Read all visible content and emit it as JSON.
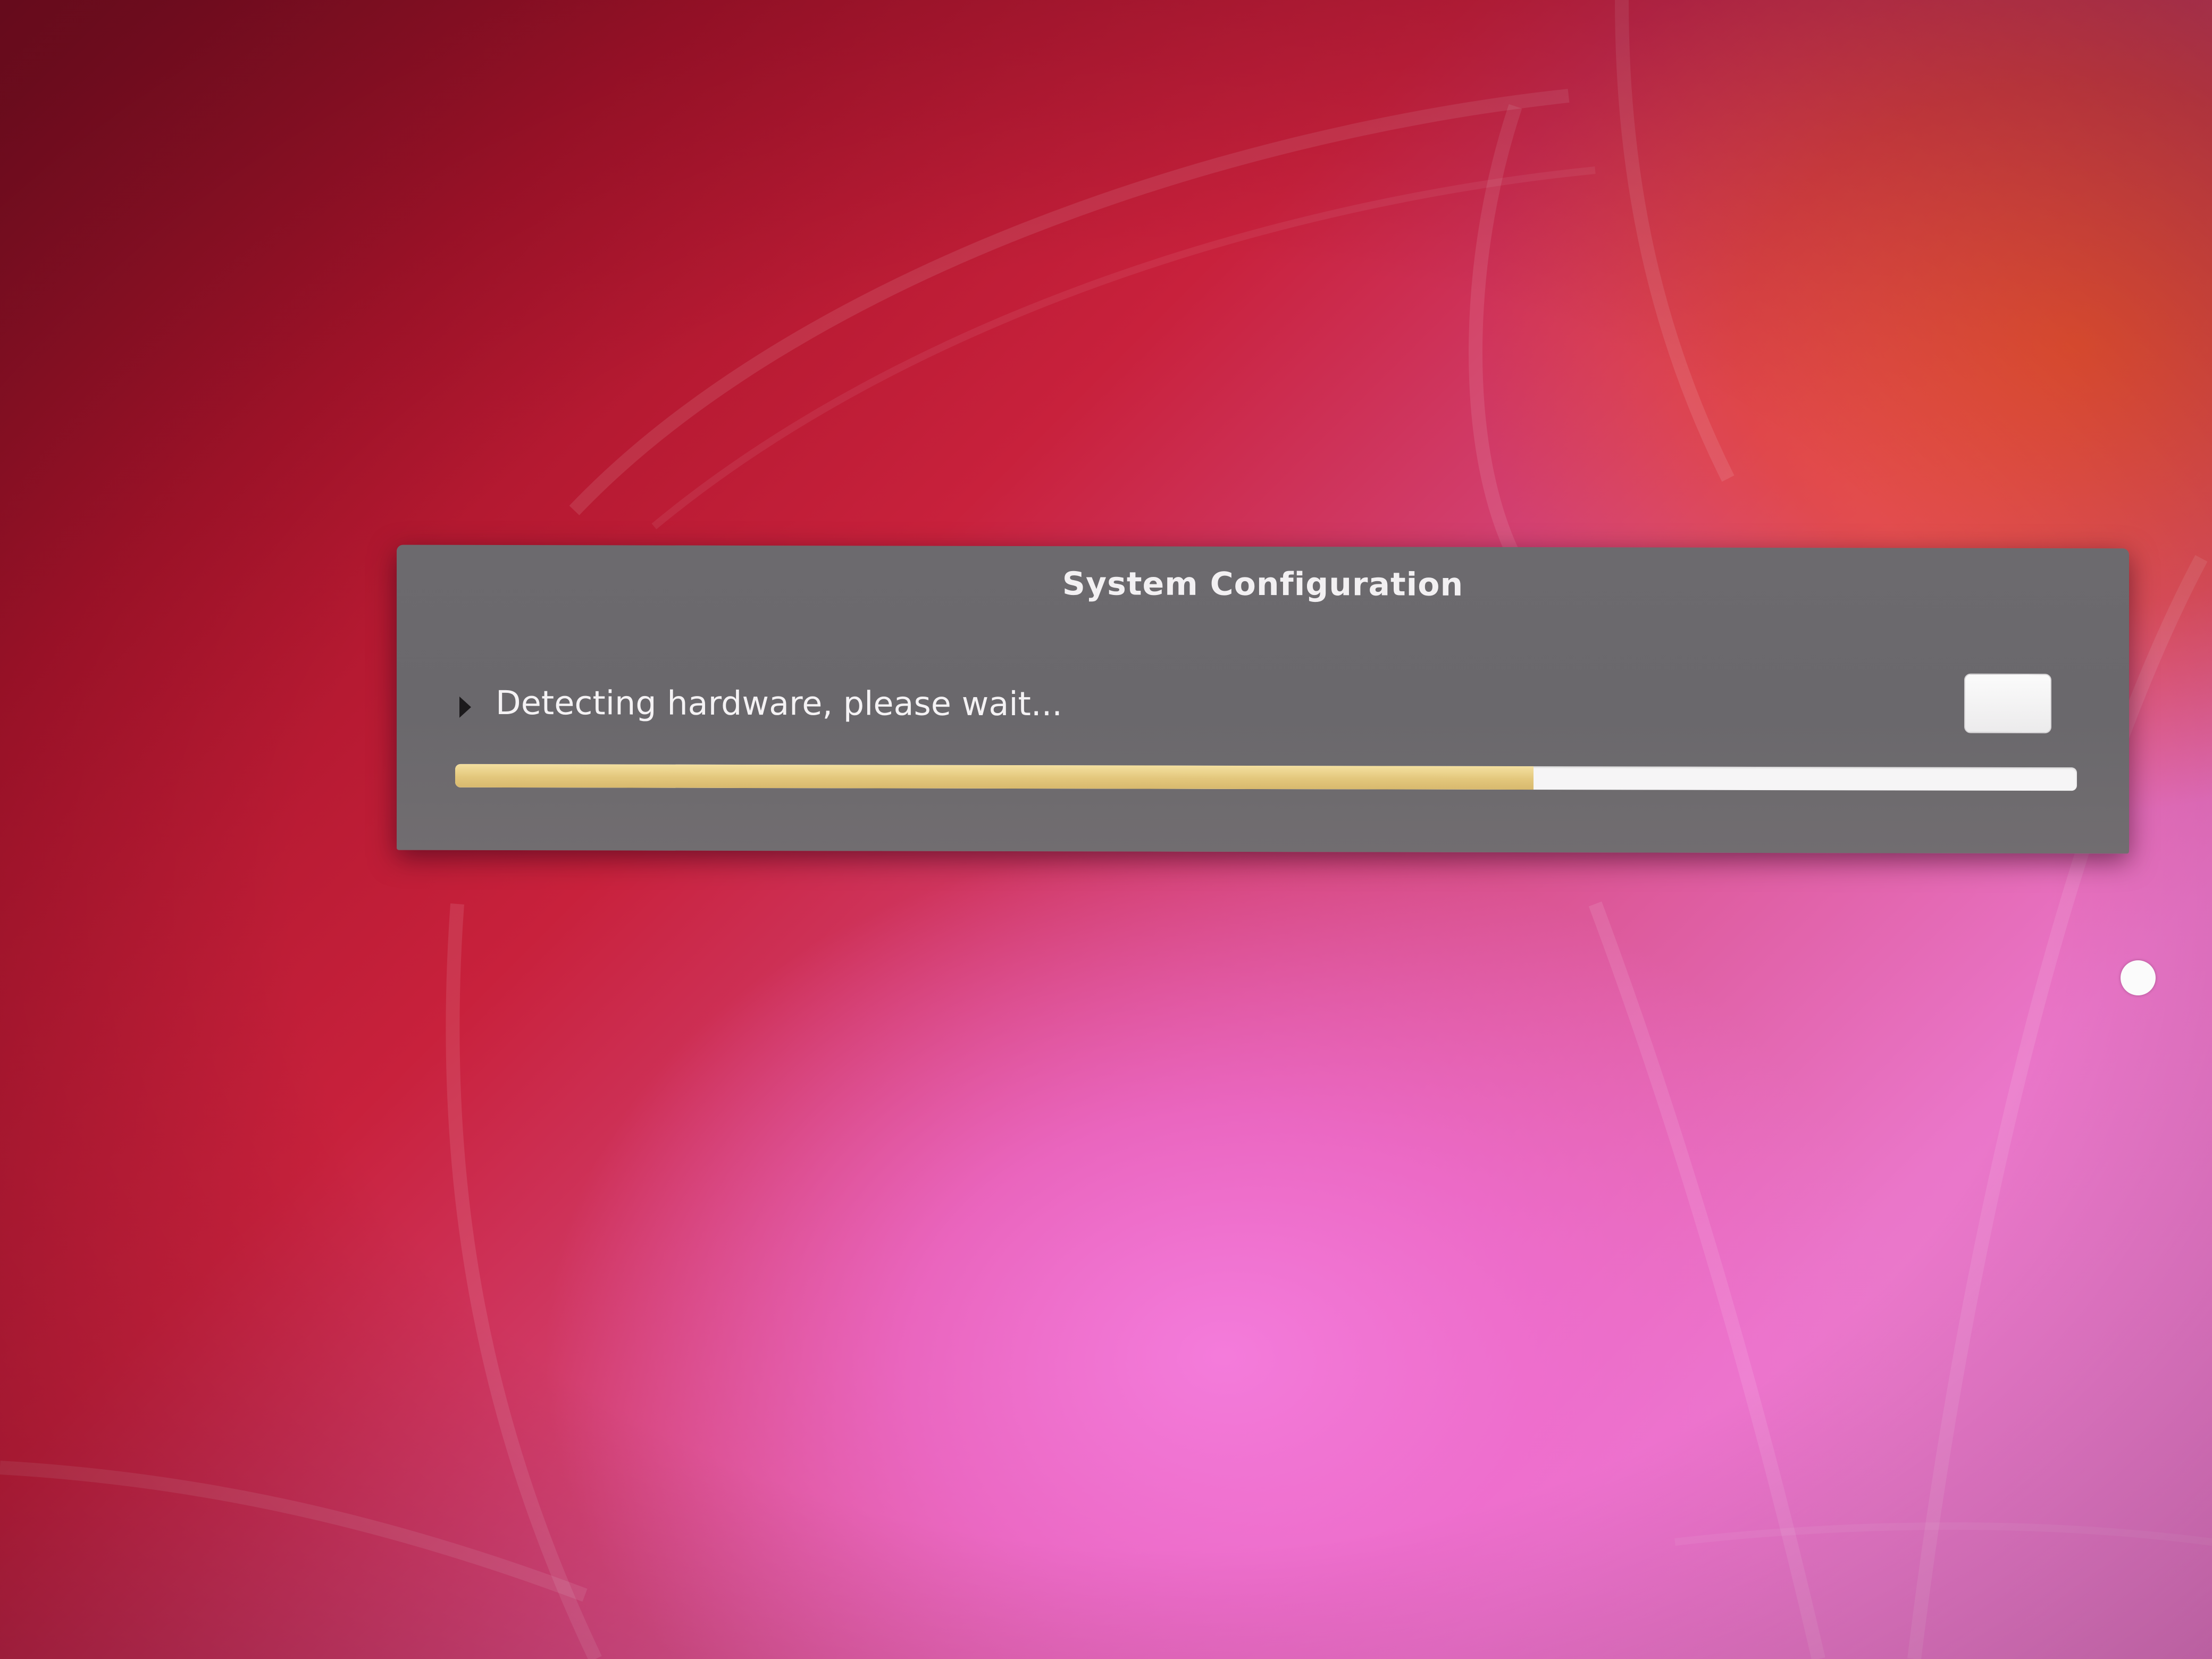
{
  "dialog": {
    "title": "System Configuration",
    "status_text": "Detecting hardware, please wait...",
    "progress_fraction": 0.665
  },
  "colors": {
    "dialog_background": "#6c6a6e",
    "progress_fill": "#e3c77c",
    "progress_track": "#f6f5f6",
    "title_text": "#f2f0f2"
  },
  "icons": {
    "expander": "triangle-right-icon",
    "cursor": "mouse-pointer-icon"
  }
}
